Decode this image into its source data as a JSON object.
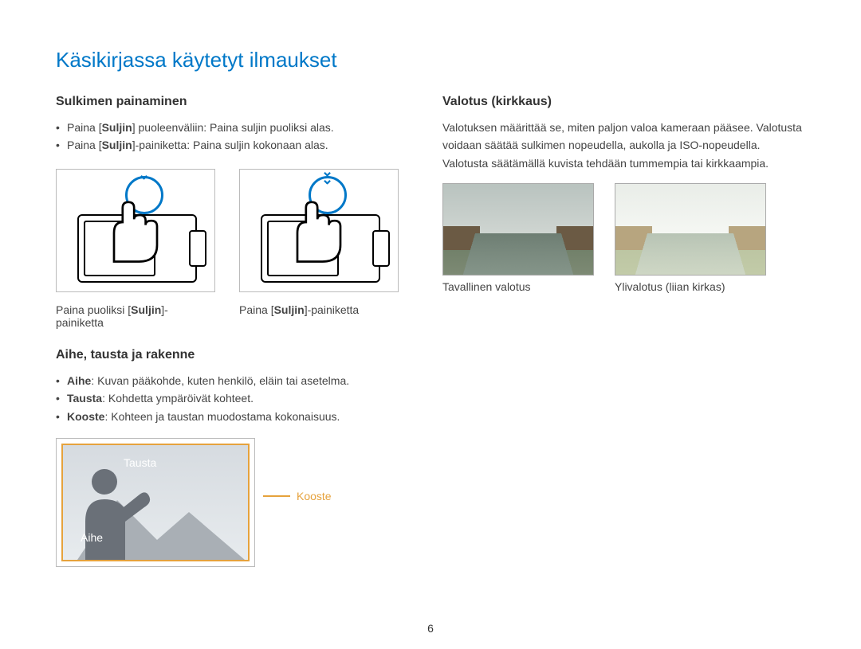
{
  "title": "Käsikirjassa käytetyt ilmaukset",
  "left": {
    "section1": {
      "heading": "Sulkimen painaminen",
      "bullet1_pre": "Paina [",
      "bullet1_b": "Suljin",
      "bullet1_post": "] puoleenväliin: Paina suljin puoliksi alas.",
      "bullet2_pre": "Paina [",
      "bullet2_b": "Suljin",
      "bullet2_post": "]-painiketta: Paina suljin kokonaan alas.",
      "cap1_pre": "Paina puoliksi [",
      "cap1_b": "Suljin",
      "cap1_post": "]-painiketta",
      "cap2_pre": "Paina [",
      "cap2_b": "Suljin",
      "cap2_post": "]-painiketta"
    },
    "section2": {
      "heading": "Aihe, tausta ja rakenne",
      "b1_b": "Aihe",
      "b1_t": ": Kuvan pääkohde, kuten henkilö, eläin tai asetelma.",
      "b2_b": "Tausta",
      "b2_t": ": Kohdetta ympäröivät kohteet.",
      "b3_b": "Kooste",
      "b3_t": ": Kohteen ja taustan muodostama kokonaisuus.",
      "label_tausta": "Tausta",
      "label_aihe": "Aihe",
      "label_kooste": "Kooste"
    }
  },
  "right": {
    "heading": "Valotus (kirkkaus)",
    "para": "Valotuksen määrittää se, miten paljon valoa kameraan pääsee. Valotusta voidaan säätää sulkimen nopeudella, aukolla ja ISO-nopeudella. Valotusta säätämällä kuvista tehdään tummempia tai kirkkaampia.",
    "cap_normal": "Tavallinen valotus",
    "cap_over": "Ylivalotus (liian kirkas)"
  },
  "page_number": "6"
}
